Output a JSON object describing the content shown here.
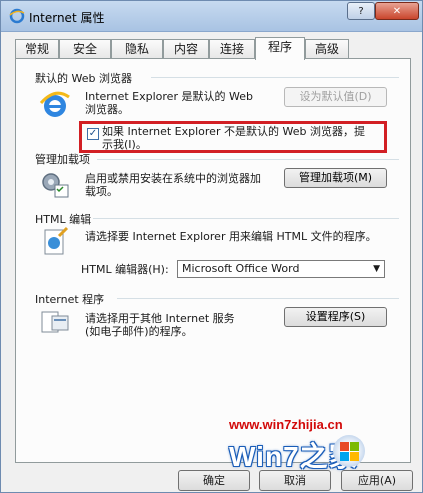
{
  "window": {
    "title": "Internet 属性",
    "help_label": "?",
    "close_label": "✕"
  },
  "tabs": [
    {
      "label": "常规"
    },
    {
      "label": "安全"
    },
    {
      "label": "隐私"
    },
    {
      "label": "内容"
    },
    {
      "label": "连接"
    },
    {
      "label": "程序",
      "active": true
    },
    {
      "label": "高级"
    }
  ],
  "default_browser": {
    "heading": "默认的 Web 浏览器",
    "description_line1": "Internet Explorer 是默认的 Web",
    "description_line2": "浏览器。",
    "button_label": "设为默认值(D)",
    "checkbox_checked": true,
    "checkbox_line1": "如果 Internet Explorer 不是默认的 Web 浏览器，提",
    "checkbox_line2": "示我(I)。"
  },
  "addons": {
    "heading": "管理加载项",
    "description_line1": "启用或禁用安装在系统中的浏览器加",
    "description_line2": "载项。",
    "button_label": "管理加载项(M)"
  },
  "html_editing": {
    "heading": "HTML 编辑",
    "description": "请选择要 Internet Explorer 用来编辑 HTML 文件的程序。",
    "editor_label": "HTML 编辑器(H):",
    "editor_value": "Microsoft Office Word"
  },
  "internet_programs": {
    "heading": "Internet 程序",
    "description_line1": "请选择用于其他 Internet 服务",
    "description_line2": "(如电子邮件)的程序。",
    "button_label": "设置程序(S)"
  },
  "footer": {
    "ok_label": "确定",
    "cancel_label": "取消",
    "apply_label": "应用(A)"
  },
  "watermark": {
    "url": "www.win7zhijia.cn",
    "logo": "Win7之家"
  },
  "colors": {
    "highlight_box": "#d21f24",
    "panel": "#fcfcfc",
    "titlebar": "#b9cfea"
  }
}
